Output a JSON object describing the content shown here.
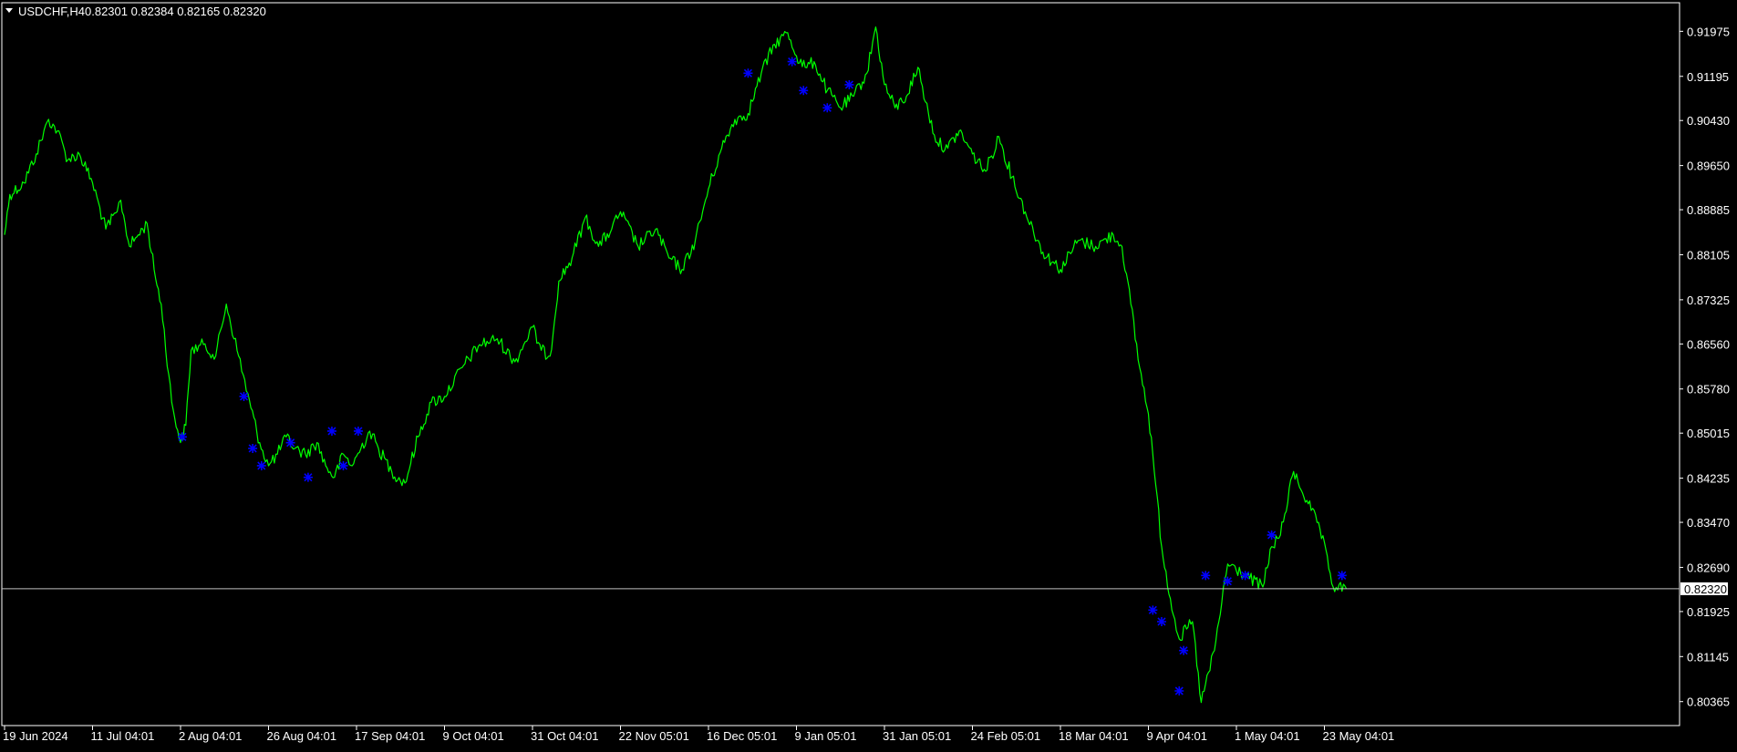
{
  "window": {
    "symbol_header": "USDCHF,H4",
    "ohlc_text": "0.82301 0.82384 0.82165 0.82320",
    "chevron_icon": "triangle-down-icon"
  },
  "colors": {
    "background": "#000000",
    "frame": "#ffffff",
    "price_line": "#00ff00",
    "markers": "#0000ff",
    "current_price_line": "#c0c0c0",
    "current_price_label_bg": "#ffffff",
    "current_price_label_text": "#000000",
    "text": "#ffffff"
  },
  "chart_data": {
    "type": "line",
    "title": "USDCHF,H4",
    "xlabel": "",
    "ylabel": "",
    "grid": false,
    "legend": "none",
    "x_ticks": [
      "19 Jun 2024",
      "11 Jul 04:01",
      "2 Aug 04:01",
      "26 Aug 04:01",
      "17 Sep 04:01",
      "9 Oct 04:01",
      "31 Oct 04:01",
      "22 Nov 05:01",
      "16 Dec 05:01",
      "9 Jan 05:01",
      "31 Jan 05:01",
      "24 Feb 05:01",
      "18 Mar 04:01",
      "9 Apr 04:01",
      "1 May 04:01",
      "23 May 04:01"
    ],
    "y_ticks": [
      "0.91975",
      "0.91195",
      "0.90430",
      "0.89650",
      "0.88885",
      "0.88105",
      "0.87325",
      "0.86560",
      "0.85780",
      "0.85015",
      "0.84235",
      "0.83470",
      "0.82690",
      "0.81925",
      "0.81145",
      "0.80365"
    ],
    "ylim": [
      0.7995,
      0.9247
    ],
    "xlim": [
      0,
      15.5
    ],
    "current_price": "0.82320",
    "series": [
      {
        "x": [
          0.0,
          0.06,
          0.22,
          0.36,
          0.5,
          0.6,
          0.72,
          0.85,
          1.0,
          1.15,
          1.28,
          1.32,
          1.42,
          1.52,
          1.62,
          1.7,
          1.78,
          1.9,
          2.0,
          2.06,
          2.12,
          2.26,
          2.4,
          2.52,
          2.66,
          2.8,
          2.9,
          3.0,
          3.1,
          3.2,
          3.3,
          3.42,
          3.55,
          3.65,
          3.75,
          3.85,
          3.95,
          4.05,
          4.15,
          4.25,
          4.4,
          4.55,
          4.7,
          4.85,
          5.0,
          5.2,
          5.4,
          5.6,
          5.8,
          6.0,
          6.1,
          6.2,
          6.3,
          6.45,
          6.6,
          6.75,
          6.9,
          7.0,
          7.2,
          7.4,
          7.55,
          7.7,
          7.85,
          8.0,
          8.15,
          8.3,
          8.45,
          8.6,
          8.75,
          8.9,
          9.0,
          9.1,
          9.2,
          9.35,
          9.5,
          9.65,
          9.8,
          9.9,
          10.0,
          10.12,
          10.25,
          10.38,
          10.5,
          10.6,
          10.72,
          10.85,
          11.0,
          11.15,
          11.3,
          11.45,
          11.6,
          11.8,
          12.0,
          12.2,
          12.4,
          12.6,
          12.7,
          12.8,
          12.9,
          13.0,
          13.05,
          13.15,
          13.25,
          13.35,
          13.5,
          13.6,
          13.75,
          13.9,
          14.1,
          14.3,
          14.4,
          14.5,
          14.65,
          14.8,
          14.95,
          15.1,
          15.25
        ],
        "values": [
          0.8845,
          0.8915,
          0.8935,
          0.8985,
          0.9045,
          0.9025,
          0.8975,
          0.8985,
          0.8935,
          0.8855,
          0.8885,
          0.8905,
          0.8825,
          0.8845,
          0.8865,
          0.8785,
          0.8725,
          0.8555,
          0.8485,
          0.8515,
          0.8645,
          0.8655,
          0.8635,
          0.8725,
          0.8635,
          0.8545,
          0.8485,
          0.8445,
          0.8465,
          0.8495,
          0.8475,
          0.8465,
          0.8485,
          0.8445,
          0.8425,
          0.8465,
          0.8445,
          0.8475,
          0.8505,
          0.8475,
          0.8435,
          0.8415,
          0.8495,
          0.8555,
          0.8565,
          0.8615,
          0.8655,
          0.8665,
          0.8625,
          0.8685,
          0.8645,
          0.8635,
          0.8765,
          0.8805,
          0.8875,
          0.8825,
          0.8855,
          0.8885,
          0.8825,
          0.8855,
          0.8805,
          0.8785,
          0.8835,
          0.8925,
          0.8995,
          0.9045,
          0.9055,
          0.9125,
          0.9175,
          0.9195,
          0.9155,
          0.9135,
          0.9145,
          0.9095,
          0.9065,
          0.9085,
          0.9125,
          0.9205,
          0.9105,
          0.9065,
          0.9085,
          0.9135,
          0.9055,
          0.9005,
          0.8995,
          0.9025,
          0.8985,
          0.8955,
          0.9015,
          0.8945,
          0.8885,
          0.8815,
          0.8785,
          0.8835,
          0.8825,
          0.8845,
          0.8825,
          0.8725,
          0.8615,
          0.8535,
          0.8465,
          0.8305,
          0.8215,
          0.8145,
          0.8175,
          0.8035,
          0.8125,
          0.8275,
          0.8255,
          0.8235,
          0.8305,
          0.8325,
          0.8435,
          0.8385,
          0.8335,
          0.8235,
          0.8232
        ]
      }
    ],
    "markers": {
      "x": [
        2.02,
        2.72,
        2.82,
        2.92,
        3.25,
        3.45,
        3.72,
        3.85,
        4.02,
        8.45,
        8.95,
        9.08,
        9.35,
        9.6,
        13.05,
        13.35,
        13.15,
        13.4,
        13.65,
        13.9,
        14.1,
        14.4,
        15.2
      ],
      "values": [
        0.8495,
        0.8565,
        0.8475,
        0.8445,
        0.8485,
        0.8425,
        0.8505,
        0.8445,
        0.8505,
        0.9125,
        0.9145,
        0.9095,
        0.9065,
        0.9105,
        0.8195,
        0.8055,
        0.8175,
        0.8125,
        0.8255,
        0.8245,
        0.8255,
        0.8325,
        0.8255
      ]
    }
  }
}
